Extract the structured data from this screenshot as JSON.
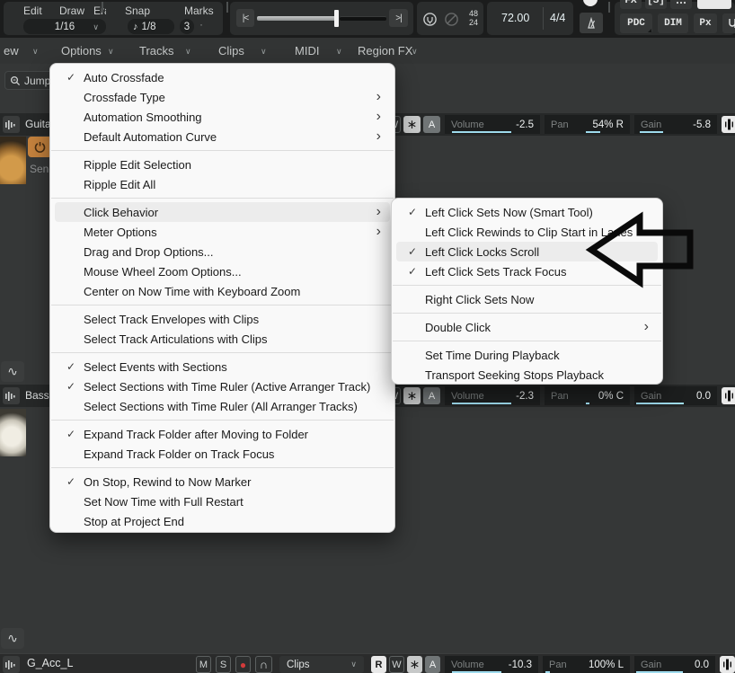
{
  "icons": {
    "chevron": "∨",
    "note": "♪",
    "dot": "·",
    "asterisk": "∗",
    "record": "●",
    "headphones": "∩",
    "envelope": "∿",
    "check": "✓",
    "submenu_arrow": "›"
  },
  "colors": {
    "accent_cyan": "#9edbed",
    "record_red": "#d23b3b",
    "power_orange": "#c5823d",
    "annotation_black": "#0a0a0a"
  },
  "toolbar": {
    "edit": "Edit",
    "draw": "Draw",
    "erase": "Erase",
    "grid": "1/16",
    "snap": "Snap",
    "marks": "Marks",
    "note_value": "1/8",
    "snap_count": "3",
    "rtz": "|<",
    "rte": ">|",
    "sr_top": "48",
    "sr_bottom": "24",
    "tempo": "72.00",
    "meter": "4/4",
    "pdc": "PDC",
    "dim": "DIM",
    "px": "Px",
    "fx": "FX",
    "s_bracket": "[S]"
  },
  "menubar": {
    "view": "ew",
    "options": "Options",
    "tracks": "Tracks",
    "clips": "Clips",
    "midi": "MIDI",
    "region_fx": "Region FX"
  },
  "left_panel": {
    "jump": "Jump",
    "track1_name": "Guita",
    "send_label": "Send",
    "track2_name": "Bass"
  },
  "options_menu": {
    "items": [
      {
        "label": "Auto Crossfade",
        "checked": true
      },
      {
        "label": "Crossfade Type",
        "arrow": true
      },
      {
        "label": "Automation Smoothing",
        "arrow": true
      },
      {
        "label": "Default Automation Curve",
        "arrow": true
      },
      {
        "sep": true
      },
      {
        "label": "Ripple Edit Selection"
      },
      {
        "label": "Ripple Edit All"
      },
      {
        "sep": true
      },
      {
        "label": "Click Behavior",
        "arrow": true,
        "highlight": true
      },
      {
        "label": "Meter Options",
        "arrow": true
      },
      {
        "label": "Drag and Drop Options..."
      },
      {
        "label": "Mouse Wheel Zoom Options..."
      },
      {
        "label": "Center on Now Time with Keyboard Zoom"
      },
      {
        "sep": true
      },
      {
        "label": "Select Track Envelopes with Clips"
      },
      {
        "label": "Select Track Articulations with Clips"
      },
      {
        "sep": true
      },
      {
        "label": "Select Events with Sections",
        "checked": true
      },
      {
        "label": "Select Sections with Time Ruler (Active Arranger Track)",
        "checked": true
      },
      {
        "label": "Select Sections with Time Ruler (All Arranger Tracks)"
      },
      {
        "sep": true
      },
      {
        "label": "Expand Track Folder after Moving to Folder",
        "checked": true
      },
      {
        "label": "Expand Track Folder on Track Focus"
      },
      {
        "sep": true
      },
      {
        "label": "On Stop, Rewind to Now Marker",
        "checked": true
      },
      {
        "label": "Set Now Time with Full Restart"
      },
      {
        "label": "Stop at Project End"
      }
    ]
  },
  "click_behavior_menu": {
    "items": [
      {
        "label": "Left Click Sets Now (Smart Tool)",
        "checked": true
      },
      {
        "label": "Left Click Rewinds to Clip Start in Lanes"
      },
      {
        "label": "Left Click Locks Scroll",
        "checked": true,
        "highlight": true
      },
      {
        "label": "Left Click Sets Track Focus",
        "checked": true
      },
      {
        "sep": true
      },
      {
        "label": "Right Click Sets Now"
      },
      {
        "sep": true
      },
      {
        "label": "Double Click",
        "arrow": true
      },
      {
        "sep": true
      },
      {
        "label": "Set Time During Playback"
      },
      {
        "label": "Transport Seeking Stops Playback"
      }
    ]
  },
  "strips": {
    "labels": {
      "volume": "Volume",
      "pan": "Pan",
      "gain": "Gain",
      "w": "W",
      "a": "A",
      "r": "R",
      "m": "M",
      "s": "S"
    },
    "track1": {
      "volume": "-2.5",
      "pan": "54% R",
      "gain": "-5.8"
    },
    "track2": {
      "volume": "-2.3",
      "pan": "0% C",
      "gain": "0.0"
    },
    "bottom": {
      "name": "G_Acc_L",
      "mode": "Clips",
      "volume": "-10.3",
      "pan": "100% L",
      "gain": "0.0"
    }
  }
}
